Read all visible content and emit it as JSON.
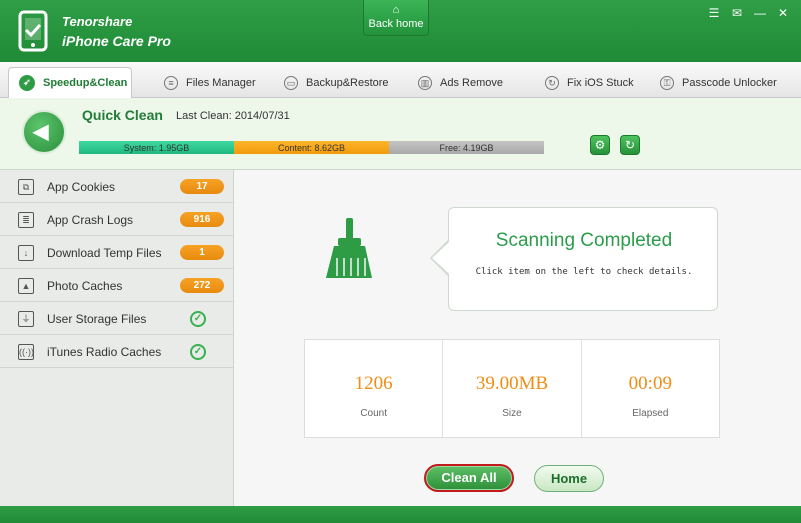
{
  "app": {
    "brand_line1": "Tenorshare",
    "brand_line2": "iPhone Care Pro",
    "back_home": "Back home"
  },
  "nav": {
    "tabs": [
      {
        "label": "Speedup&Clean",
        "icon": "rocket-icon",
        "active": true
      },
      {
        "label": "Files Manager",
        "icon": "files-icon"
      },
      {
        "label": "Backup&Restore",
        "icon": "folder-icon"
      },
      {
        "label": "Ads Remove",
        "icon": "trash-icon"
      },
      {
        "label": "Fix iOS Stuck",
        "icon": "refresh-icon"
      },
      {
        "label": "Passcode Unlocker",
        "icon": "lock-icon"
      }
    ]
  },
  "quick_clean": {
    "title": "Quick Clean",
    "last_clean": "Last Clean: 2014/07/31",
    "storage": {
      "system": "System: 1.95GB",
      "content": "Content: 8.62GB",
      "free": "Free: 4.19GB"
    },
    "colors": {
      "system": "#1fb87f",
      "content": "#f09b0c",
      "free": "#a9a9a9"
    }
  },
  "sidebar": {
    "items": [
      {
        "label": "App Cookies",
        "badge": "17",
        "icon": "cookie-icon"
      },
      {
        "label": "App Crash Logs",
        "badge": "916",
        "icon": "log-icon"
      },
      {
        "label": "Download Temp Files",
        "badge": "1",
        "icon": "download-icon"
      },
      {
        "label": "Photo Caches",
        "badge": "272",
        "icon": "photo-icon"
      },
      {
        "label": "User Storage Files",
        "done": true,
        "icon": "usb-icon"
      },
      {
        "label": "iTunes Radio Caches",
        "done": true,
        "icon": "radio-icon"
      }
    ]
  },
  "main": {
    "scan_title": "Scanning Completed",
    "scan_sub": "Click item on the left to check details.",
    "stats": [
      {
        "value": "1206",
        "label": "Count"
      },
      {
        "value": "39.00MB",
        "label": "Size"
      },
      {
        "value": "00:09",
        "label": "Elapsed"
      }
    ],
    "clean_all": "Clean All",
    "home": "Home"
  },
  "colors": {
    "brand_green": "#2f9e45",
    "accent_orange": "#f08d14"
  }
}
